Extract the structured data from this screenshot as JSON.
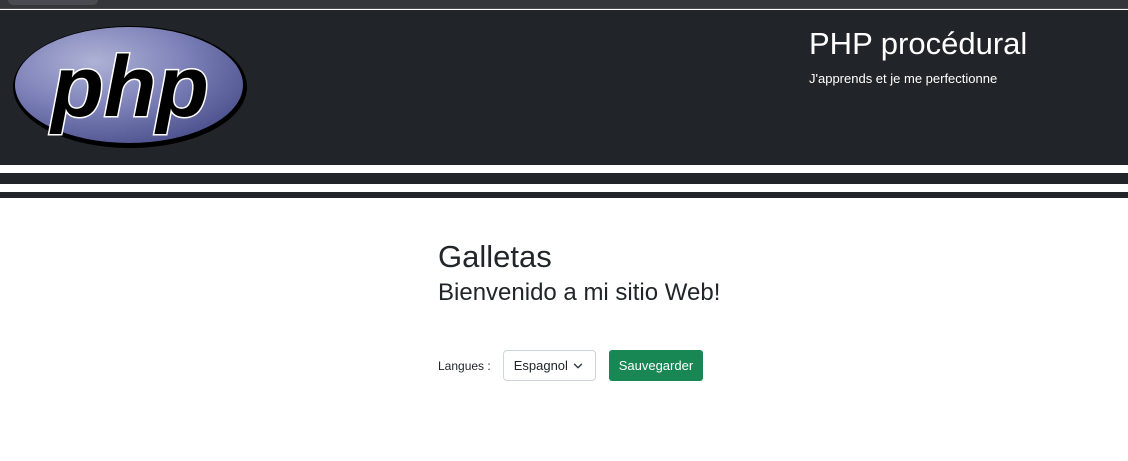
{
  "header": {
    "logo_icon": "php-logo",
    "logo_text": "php",
    "title": "PHP procédural",
    "subtitle": "J'apprends et je me perfectionne"
  },
  "main": {
    "heading": "Galletas",
    "welcome": "Bienvenido a mi sitio Web!"
  },
  "form": {
    "language_label": "Langues :",
    "language_selected": "Espagnol",
    "save_label": "Sauvegarder"
  },
  "colors": {
    "header_bg": "#212529",
    "save_button": "#198754",
    "logo_blue": "#7377ad"
  }
}
